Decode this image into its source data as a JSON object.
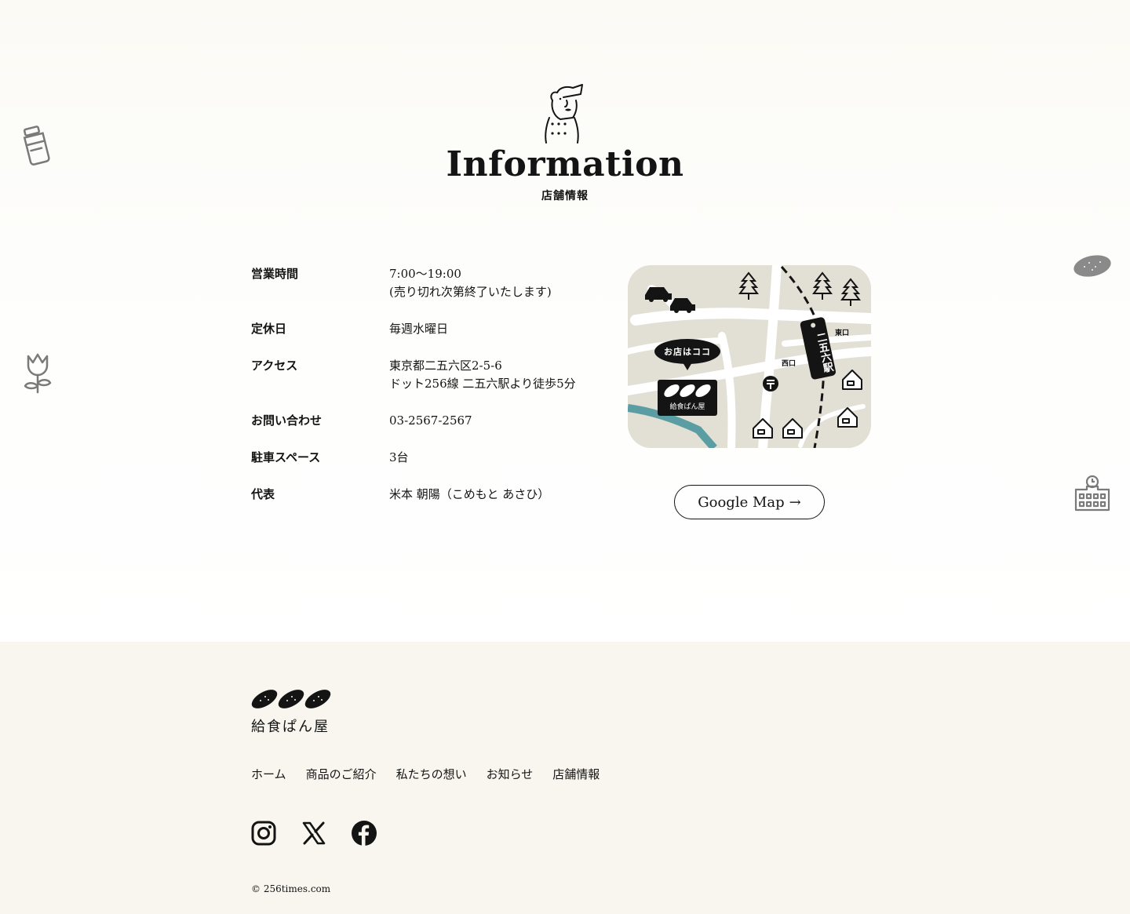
{
  "header": {
    "title": "Information",
    "subtitle": "店舗情報"
  },
  "info": {
    "rows": [
      {
        "label": "営業時間",
        "value": "7:00〜19:00\n(売り切れ次第終了いたします)"
      },
      {
        "label": "定休日",
        "value": "毎週水曜日"
      },
      {
        "label": "アクセス",
        "value": "東京都二五六区2-5-6\nドット256線 二五六駅より徒歩5分"
      },
      {
        "label": "お問い合わせ",
        "value": "03-2567-2567"
      },
      {
        "label": "駐車スペース",
        "value": "3台"
      },
      {
        "label": "代表",
        "value": "米本 朝陽（こめもと あさひ）"
      }
    ]
  },
  "map": {
    "bubble_text": "お店はココ",
    "shop_sign": "給食ぱん屋",
    "station_name": "二五六駅",
    "east_exit": "東口",
    "west_exit": "西口",
    "road_color": "#ffffff",
    "ground_color": "#e2dfd4",
    "river_color": "#5a9ea3",
    "button_label": "Google Map",
    "button_icon": "arrow-right-icon"
  },
  "footer": {
    "logo_text": "給食ぱん屋",
    "nav": [
      "ホーム",
      "商品のご紹介",
      "私たちの想い",
      "お知らせ",
      "店舗情報"
    ],
    "social_icons": [
      "instagram-icon",
      "x-icon",
      "facebook-icon"
    ],
    "copyright": "© 256times.com",
    "background": "#f8f6ef"
  }
}
